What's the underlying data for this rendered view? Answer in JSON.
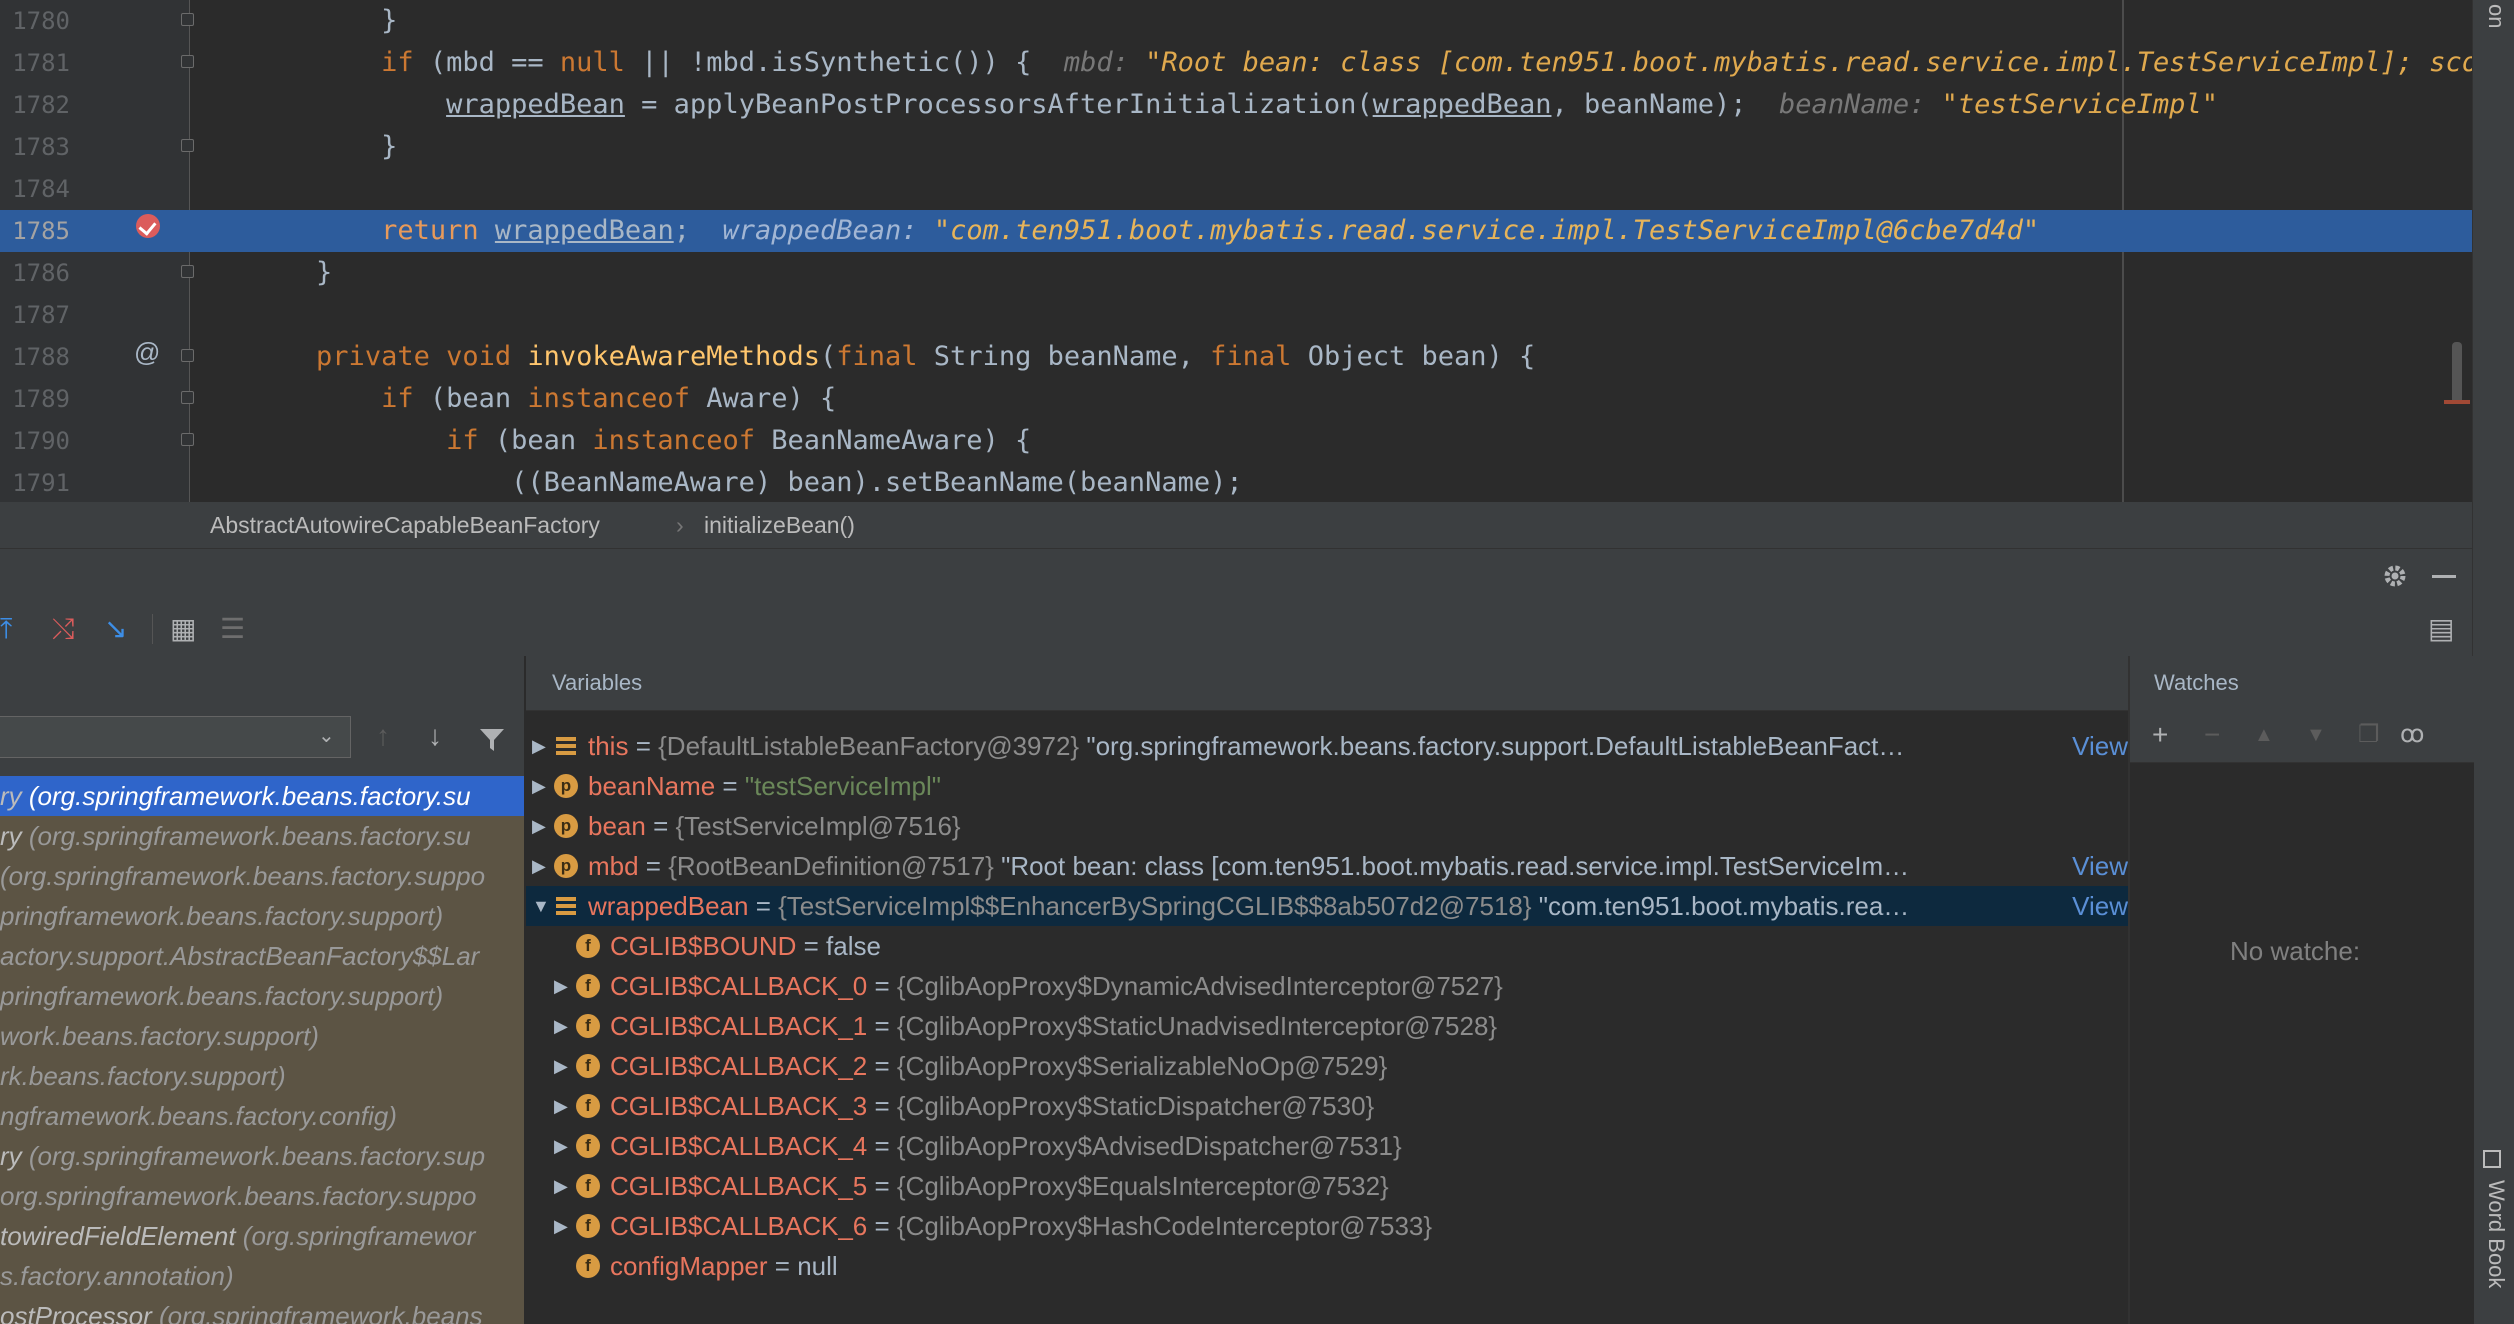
{
  "editor": {
    "lines": [
      {
        "n": "1780",
        "html": "            }"
      },
      {
        "n": "1781",
        "html": "            <span class='kw'>if</span> (mbd == <span class='kw'>null</span> || !mbd.isSynthetic()) {  <span class='hint'>mbd: </span><span class='sv'>\"Root bean: class [com.ten951.boot.mybatis.read.service.impl.TestServiceImpl]; scope=si</span>"
      },
      {
        "n": "1782",
        "html": "                <span class='ul'>wrappedBean</span> = applyBeanPostProcessorsAfterInitialization(<span class='ul'>wrappedBean</span>, beanName);  <span class='hint'>beanName: </span><span class='sv'>\"testServiceImpl\"</span>"
      },
      {
        "n": "1783",
        "html": "            }"
      },
      {
        "n": "1784",
        "html": ""
      },
      {
        "n": "1785",
        "html": "            <span class='kw'>return</span> <span class='ul'>wrappedBean</span>;  <span class='hint'>wrappedBean: </span><span class='sv'>\"com.ten951.boot.mybatis.read.service.impl.TestServiceImpl@6cbe7d4d\"</span>"
      },
      {
        "n": "1786",
        "html": "        }"
      },
      {
        "n": "1787",
        "html": ""
      },
      {
        "n": "1788",
        "html": "        <span class='kw'>private void</span> <span class='fn'>invokeAwareMethods</span>(<span class='kw'>final</span> String beanName, <span class='kw'>final</span> Object bean) {"
      },
      {
        "n": "1789",
        "html": "            <span class='kw'>if</span> (bean <span class='kw'>instanceof</span> Aware) {"
      },
      {
        "n": "1790",
        "html": "                <span class='kw'>if</span> (bean <span class='kw'>instanceof</span> BeanNameAware) {"
      },
      {
        "n": "1791",
        "html": "                    ((BeanNameAware) bean).setBeanName(beanName);"
      }
    ],
    "highlighted_line": "1785"
  },
  "breadcrumb": {
    "class": "AbstractAutowireCapableBeanFactory",
    "separator": "›",
    "method": "initializeBean()"
  },
  "right_strip": {
    "top_label": "on",
    "bottom_label": "Word Book"
  },
  "frames": {
    "items": [
      {
        "method": "ry ",
        "pkg": "(org.springframework.beans.factory.su",
        "selected": true
      },
      {
        "method": "ry ",
        "pkg": "(org.springframework.beans.factory.su",
        "selected": false
      },
      {
        "method": "",
        "pkg": "(org.springframework.beans.factory.suppo",
        "selected": false
      },
      {
        "method": "",
        "pkg": "pringframework.beans.factory.support)",
        "selected": false
      },
      {
        "method": "",
        "pkg": "actory.support.AbstractBeanFactory$$Lar",
        "selected": false
      },
      {
        "method": "",
        "pkg": "pringframework.beans.factory.support)",
        "selected": false
      },
      {
        "method": "",
        "pkg": "work.beans.factory.support)",
        "selected": false
      },
      {
        "method": "",
        "pkg": "rk.beans.factory.support)",
        "selected": false
      },
      {
        "method": "",
        "pkg": "ngframework.beans.factory.config)",
        "selected": false
      },
      {
        "method": "ry ",
        "pkg": "(org.springframework.beans.factory.sup",
        "selected": false
      },
      {
        "method": "",
        "pkg": "org.springframework.beans.factory.suppo",
        "selected": false
      },
      {
        "method": "towiredFieldElement ",
        "pkg": "(org.springframewor",
        "selected": false
      },
      {
        "method": "",
        "pkg": "s.factory.annotation)",
        "selected": false
      },
      {
        "method": "ostProcessor ",
        "pkg": "(org.springframework.beans",
        "selected": false
      }
    ]
  },
  "variables": {
    "title": "Variables",
    "view_label": "View",
    "rows": [
      {
        "depth": 0,
        "expander": "right",
        "icon": "this",
        "name": "this",
        "type": "{DefaultListableBeanFactory@3972}",
        "value": " \"org.springframework.beans.factory.support.DefaultListableBeanFact…",
        "view": true,
        "valclass": "val"
      },
      {
        "depth": 0,
        "expander": "right",
        "icon": "p",
        "name": "beanName",
        "type": "",
        "value": "\"testServiceImpl\"",
        "view": false,
        "valclass": "str"
      },
      {
        "depth": 0,
        "expander": "right",
        "icon": "p",
        "name": "bean",
        "type": "{TestServiceImpl@7516}",
        "value": "",
        "view": false,
        "valclass": "val"
      },
      {
        "depth": 0,
        "expander": "right",
        "icon": "p",
        "name": "mbd",
        "type": "{RootBeanDefinition@7517}",
        "value": " \"Root bean: class [com.ten951.boot.mybatis.read.service.impl.TestServiceIm…",
        "view": true,
        "valclass": "val"
      },
      {
        "depth": 0,
        "expander": "down",
        "icon": "this",
        "name": "wrappedBean",
        "type": "{TestServiceImpl$$EnhancerBySpringCGLIB$$8ab507d2@7518}",
        "value": " \"com.ten951.boot.mybatis.rea…",
        "view": true,
        "valclass": "val",
        "selected": true
      },
      {
        "depth": 1,
        "expander": "",
        "icon": "f",
        "name": "CGLIB$BOUND",
        "type": "",
        "value": "false",
        "view": false,
        "valclass": "val"
      },
      {
        "depth": 1,
        "expander": "right",
        "icon": "f",
        "name": "CGLIB$CALLBACK_0",
        "type": "{CglibAopProxy$DynamicAdvisedInterceptor@7527}",
        "value": "",
        "view": false,
        "valclass": "val"
      },
      {
        "depth": 1,
        "expander": "right",
        "icon": "f",
        "name": "CGLIB$CALLBACK_1",
        "type": "{CglibAopProxy$StaticUnadvisedInterceptor@7528}",
        "value": "",
        "view": false,
        "valclass": "val"
      },
      {
        "depth": 1,
        "expander": "right",
        "icon": "f",
        "name": "CGLIB$CALLBACK_2",
        "type": "{CglibAopProxy$SerializableNoOp@7529}",
        "value": "",
        "view": false,
        "valclass": "val"
      },
      {
        "depth": 1,
        "expander": "right",
        "icon": "f",
        "name": "CGLIB$CALLBACK_3",
        "type": "{CglibAopProxy$StaticDispatcher@7530}",
        "value": "",
        "view": false,
        "valclass": "val"
      },
      {
        "depth": 1,
        "expander": "right",
        "icon": "f",
        "name": "CGLIB$CALLBACK_4",
        "type": "{CglibAopProxy$AdvisedDispatcher@7531}",
        "value": "",
        "view": false,
        "valclass": "val"
      },
      {
        "depth": 1,
        "expander": "right",
        "icon": "f",
        "name": "CGLIB$CALLBACK_5",
        "type": "{CglibAopProxy$EqualsInterceptor@7532}",
        "value": "",
        "view": false,
        "valclass": "val"
      },
      {
        "depth": 1,
        "expander": "right",
        "icon": "f",
        "name": "CGLIB$CALLBACK_6",
        "type": "{CglibAopProxy$HashCodeInterceptor@7533}",
        "value": "",
        "view": false,
        "valclass": "val"
      },
      {
        "depth": 1,
        "expander": "",
        "icon": "f",
        "name": "configMapper",
        "type": "",
        "value": "null",
        "view": false,
        "valclass": "val"
      }
    ]
  },
  "watches": {
    "title": "Watches",
    "empty_text": "No watche:"
  },
  "colors": {
    "editor_bg": "#2b2b2b",
    "highlight": "#2d5c9c",
    "keyword": "#cc7832",
    "string": "#6a8759",
    "var_name": "#e8765e",
    "link": "#5a8fd6",
    "frame_selected": "#2f65ca"
  }
}
